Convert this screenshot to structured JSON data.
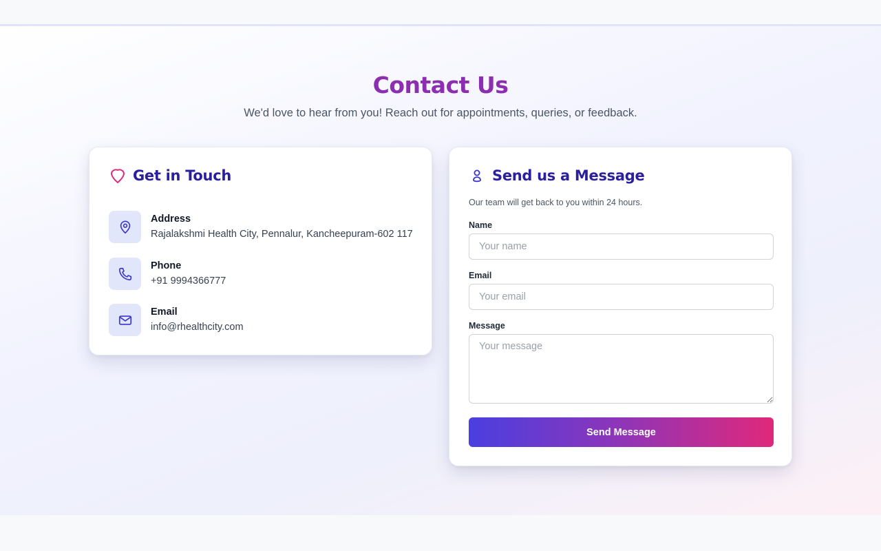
{
  "header": {
    "title": "Contact Us",
    "subtitle": "We'd love to hear from you! Reach out for appointments, queries, or feedback."
  },
  "contact_card": {
    "title": "Get in Touch",
    "title_icon": "heart-pin-icon",
    "items": [
      {
        "label": "Address",
        "value": "Rajalakshmi Health City, Pennalur, Kancheepuram-602 117",
        "icon": "map-pin-icon"
      },
      {
        "label": "Phone",
        "value": "+91 9994366777",
        "icon": "phone-icon"
      },
      {
        "label": "Email",
        "value": "info@rhealthcity.com",
        "icon": "mail-icon"
      }
    ]
  },
  "message_card": {
    "title": "Send us a Message",
    "title_icon": "person-icon",
    "note": "Our team will get back to you within 24 hours.",
    "fields": {
      "name": {
        "label": "Name",
        "placeholder": "Your name",
        "value": ""
      },
      "email": {
        "label": "Email",
        "placeholder": "Your email",
        "value": ""
      },
      "message": {
        "label": "Message",
        "placeholder": "Your message",
        "value": ""
      }
    },
    "submit_label": "Send Message"
  },
  "colors": {
    "title": "#8b2fb0",
    "card_title": "#2a1f9e",
    "icon_accent": "#3b35c9",
    "pink_accent": "#e0287a",
    "icon_bg": "#e1e6fb",
    "button_gradient": [
      "#4a3fe0",
      "#8f35b8",
      "#e0287a"
    ]
  }
}
